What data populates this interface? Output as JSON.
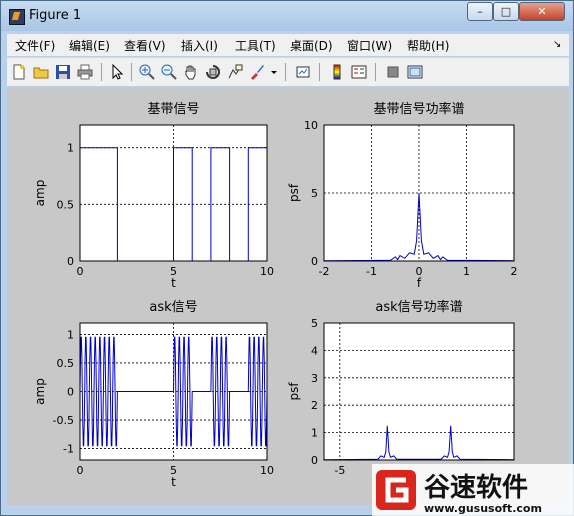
{
  "window": {
    "title": "Figure 1",
    "min": "–",
    "max": "□",
    "close": "✕"
  },
  "menu": [
    "文件(F)",
    "编辑(E)",
    "查看(V)",
    "插入(I)",
    "工具(T)",
    "桌面(D)",
    "窗口(W)",
    "帮助(H)"
  ],
  "menu_arrow": "↘",
  "toolbar_icons": [
    "new-file-icon",
    "open-folder-icon",
    "save-icon",
    "print-icon",
    "pointer-icon",
    "zoom-in-icon",
    "zoom-out-icon",
    "pan-hand-icon",
    "rotate-3d-icon",
    "data-cursor-icon",
    "brush-icon",
    "dropdown-arrow-icon",
    "link-plot-icon",
    "colorbar-icon",
    "legend-icon",
    "hide-plot-tools-icon",
    "show-plot-tools-icon"
  ],
  "watermark": {
    "brand": "谷速软件",
    "url": "www.gususoft.com"
  },
  "chart_data": [
    {
      "type": "line",
      "title": "基带信号",
      "xlabel": "t",
      "ylabel": "amp",
      "xlim": [
        0,
        10
      ],
      "ylim": [
        0,
        1.2
      ],
      "xticks": [
        "0",
        "5",
        "10"
      ],
      "yticks": [
        "0",
        "0.5",
        "1"
      ],
      "grid": true,
      "series": [
        {
          "x": [
            0,
            2,
            2,
            5,
            5,
            6,
            6,
            7,
            7,
            8,
            8,
            9,
            9,
            10
          ],
          "y": [
            1,
            1,
            0,
            0,
            1,
            1,
            0,
            0,
            1,
            1,
            0,
            0,
            1,
            1
          ]
        }
      ]
    },
    {
      "type": "line",
      "title": "基带信号功率谱",
      "xlabel": "f",
      "ylabel": "psf",
      "xlim": [
        -2,
        2
      ],
      "ylim": [
        0,
        10
      ],
      "xticks": [
        "-2",
        "-1",
        "0",
        "1",
        "2"
      ],
      "yticks": [
        "0",
        "5",
        "10"
      ],
      "grid": true,
      "series": [
        {
          "x": [
            -2,
            -0.6,
            -0.5,
            -0.45,
            -0.4,
            -0.3,
            -0.2,
            -0.1,
            -0.05,
            0,
            0.05,
            0.1,
            0.2,
            0.3,
            0.4,
            0.45,
            0.5,
            0.6,
            2
          ],
          "y": [
            0.02,
            0.05,
            0.3,
            0.1,
            0.4,
            0.2,
            0.6,
            0.5,
            1.5,
            5.0,
            1.5,
            0.5,
            0.6,
            0.2,
            0.4,
            0.1,
            0.3,
            0.05,
            0.02
          ]
        }
      ]
    },
    {
      "type": "line",
      "title": "ask信号",
      "xlabel": "t",
      "ylabel": "amp",
      "xlim": [
        0,
        10
      ],
      "ylim": [
        -1.2,
        1.2
      ],
      "xticks": [
        "0",
        "5",
        "10"
      ],
      "yticks": [
        "-1",
        "-0.5",
        "0",
        "0.5",
        "1"
      ],
      "grid": true,
      "carrier_cycles_per_unit": 2,
      "series": [
        {
          "x": [
            0,
            2,
            2,
            5,
            5,
            6,
            6,
            7,
            7,
            8,
            8,
            9,
            9,
            10
          ],
          "envelope": [
            1,
            1,
            0,
            0,
            1,
            1,
            0,
            0,
            1,
            1,
            0,
            0,
            1,
            1
          ]
        }
      ]
    },
    {
      "type": "line",
      "title": "ask信号功率谱",
      "xlabel": "",
      "ylabel": "psf",
      "xlim": [
        -6,
        6
      ],
      "ylim": [
        0,
        5
      ],
      "xticks": [
        "-5"
      ],
      "yticks": [
        "0",
        "1",
        "2",
        "3",
        "4",
        "5"
      ],
      "grid": true,
      "series": [
        {
          "x": [
            -6,
            -2.6,
            -2.4,
            -2.2,
            -2.1,
            -2.0,
            -1.9,
            -1.8,
            -1.6,
            -1.4,
            1.4,
            1.6,
            1.8,
            1.9,
            2.0,
            2.1,
            2.2,
            2.4,
            2.6,
            6
          ],
          "y": [
            0.01,
            0.03,
            0.15,
            0.1,
            0.3,
            1.25,
            0.3,
            0.1,
            0.15,
            0.03,
            0.03,
            0.15,
            0.1,
            0.3,
            1.25,
            0.3,
            0.1,
            0.15,
            0.03,
            0.01
          ]
        }
      ]
    }
  ]
}
